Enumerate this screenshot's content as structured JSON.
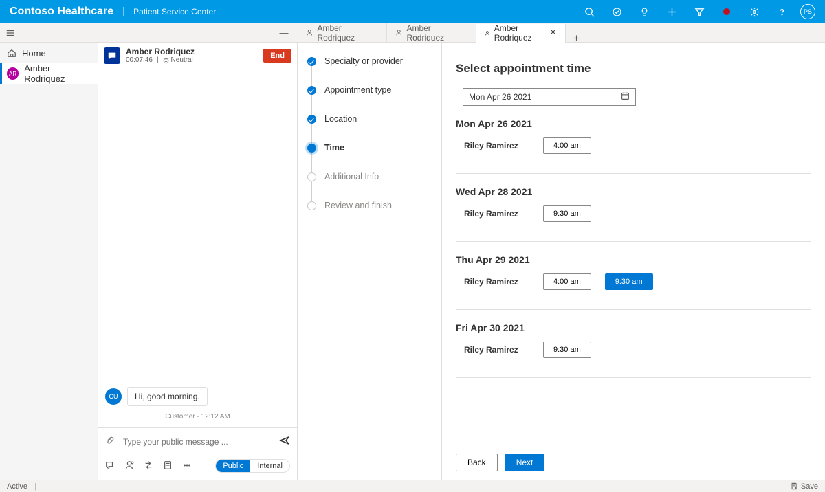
{
  "brand": {
    "name": "Contoso Healthcare",
    "sub": "Patient Service Center"
  },
  "topbar_user": "PS",
  "nav": {
    "home": "Home",
    "active": {
      "initials": "AR",
      "name": "Amber Rodriquez"
    }
  },
  "tabs": [
    {
      "label": "Amber Rodriquez",
      "active": false
    },
    {
      "label": "Amber Rodriquez",
      "active": false
    },
    {
      "label": "Amber Rodriquez",
      "active": true
    }
  ],
  "conversation": {
    "name": "Amber Rodriquez",
    "timer": "00:07:46",
    "sentiment": "Neutral",
    "end": "End",
    "message_avatar": "CU",
    "message_text": "Hi, good morning.",
    "message_meta": "Customer - 12:12 AM",
    "placeholder": "Type your public message ...",
    "seg_public": "Public",
    "seg_internal": "Internal"
  },
  "wizard": [
    {
      "label": "Specialty or provider",
      "state": "done"
    },
    {
      "label": "Appointment type",
      "state": "done"
    },
    {
      "label": "Location",
      "state": "done"
    },
    {
      "label": "Time",
      "state": "current"
    },
    {
      "label": "Additional Info",
      "state": "todo"
    },
    {
      "label": "Review and finish",
      "state": "todo"
    }
  ],
  "appointment": {
    "title": "Select appointment time",
    "date": "Mon Apr 26 2021",
    "days": [
      {
        "title": "Mon Apr 26 2021",
        "provider": "Riley Ramirez",
        "slots": [
          {
            "t": "4:00 am",
            "sel": false
          }
        ]
      },
      {
        "title": "Wed Apr 28 2021",
        "provider": "Riley Ramirez",
        "slots": [
          {
            "t": "9:30 am",
            "sel": false
          }
        ]
      },
      {
        "title": "Thu Apr 29 2021",
        "provider": "Riley Ramirez",
        "slots": [
          {
            "t": "4:00 am",
            "sel": false
          },
          {
            "t": "9:30 am",
            "sel": true
          }
        ]
      },
      {
        "title": "Fri Apr 30 2021",
        "provider": "Riley Ramirez",
        "slots": [
          {
            "t": "9:30 am",
            "sel": false
          }
        ]
      }
    ],
    "back": "Back",
    "next": "Next"
  },
  "status": {
    "state": "Active",
    "save": "Save"
  }
}
